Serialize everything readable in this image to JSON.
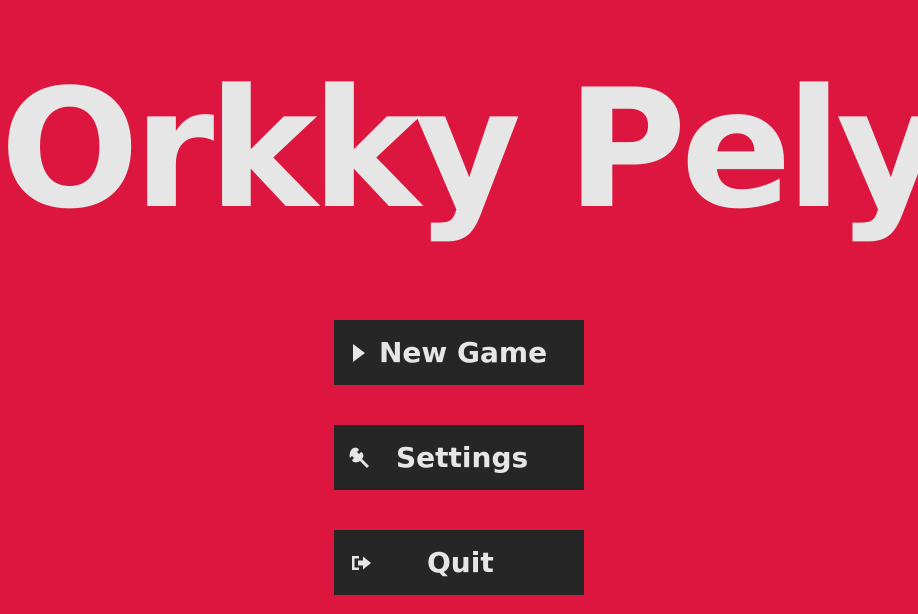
{
  "title": "Orkky Pely",
  "menu": {
    "buttons": [
      {
        "label": "New Game",
        "icon": "play-icon"
      },
      {
        "label": "Settings",
        "icon": "wrench-icon"
      },
      {
        "label": "Quit",
        "icon": "exit-icon"
      }
    ]
  },
  "colors": {
    "background": "#DC163F",
    "button": "#262626",
    "text": "#E7E6E7"
  }
}
